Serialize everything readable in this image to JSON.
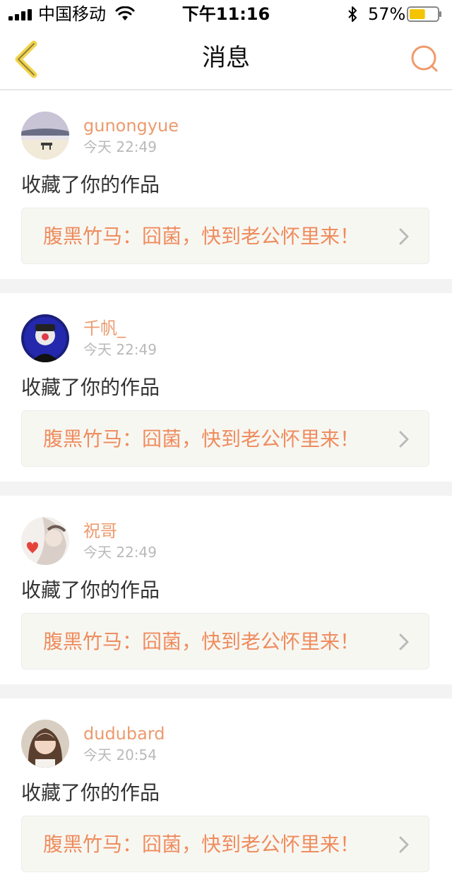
{
  "status_bar": {
    "carrier": "中国移动",
    "time": "下午11:16",
    "battery_percent": "57%",
    "battery_level": 0.57,
    "icons": [
      "signal-icon",
      "wifi-icon",
      "bluetooth-icon",
      "battery-icon"
    ]
  },
  "nav": {
    "title": "消息",
    "back_icon": "chevron-left-icon",
    "search_icon": "search-icon"
  },
  "colors": {
    "accent": "#ef8c5e",
    "username": "#ec9b6e",
    "back_icon": "#f2d44b",
    "separator": "#f3f3f3",
    "card_bg": "#f7f7f2"
  },
  "messages": [
    {
      "username": "gunongyue",
      "time": "今天 22:49",
      "action": "收藏了你的作品",
      "work_title": "腹黑竹马：囧菌，快到老公怀里来！"
    },
    {
      "username": "千帆_",
      "time": "今天 22:49",
      "action": "收藏了你的作品",
      "work_title": "腹黑竹马：囧菌，快到老公怀里来！"
    },
    {
      "username": "祝哥",
      "time": "今天 22:49",
      "action": "收藏了你的作品",
      "work_title": "腹黑竹马：囧菌，快到老公怀里来！"
    },
    {
      "username": "dudubard",
      "time": "今天 20:54",
      "action": "收藏了你的作品",
      "work_title": "腹黑竹马：囧菌，快到老公怀里来！"
    }
  ]
}
